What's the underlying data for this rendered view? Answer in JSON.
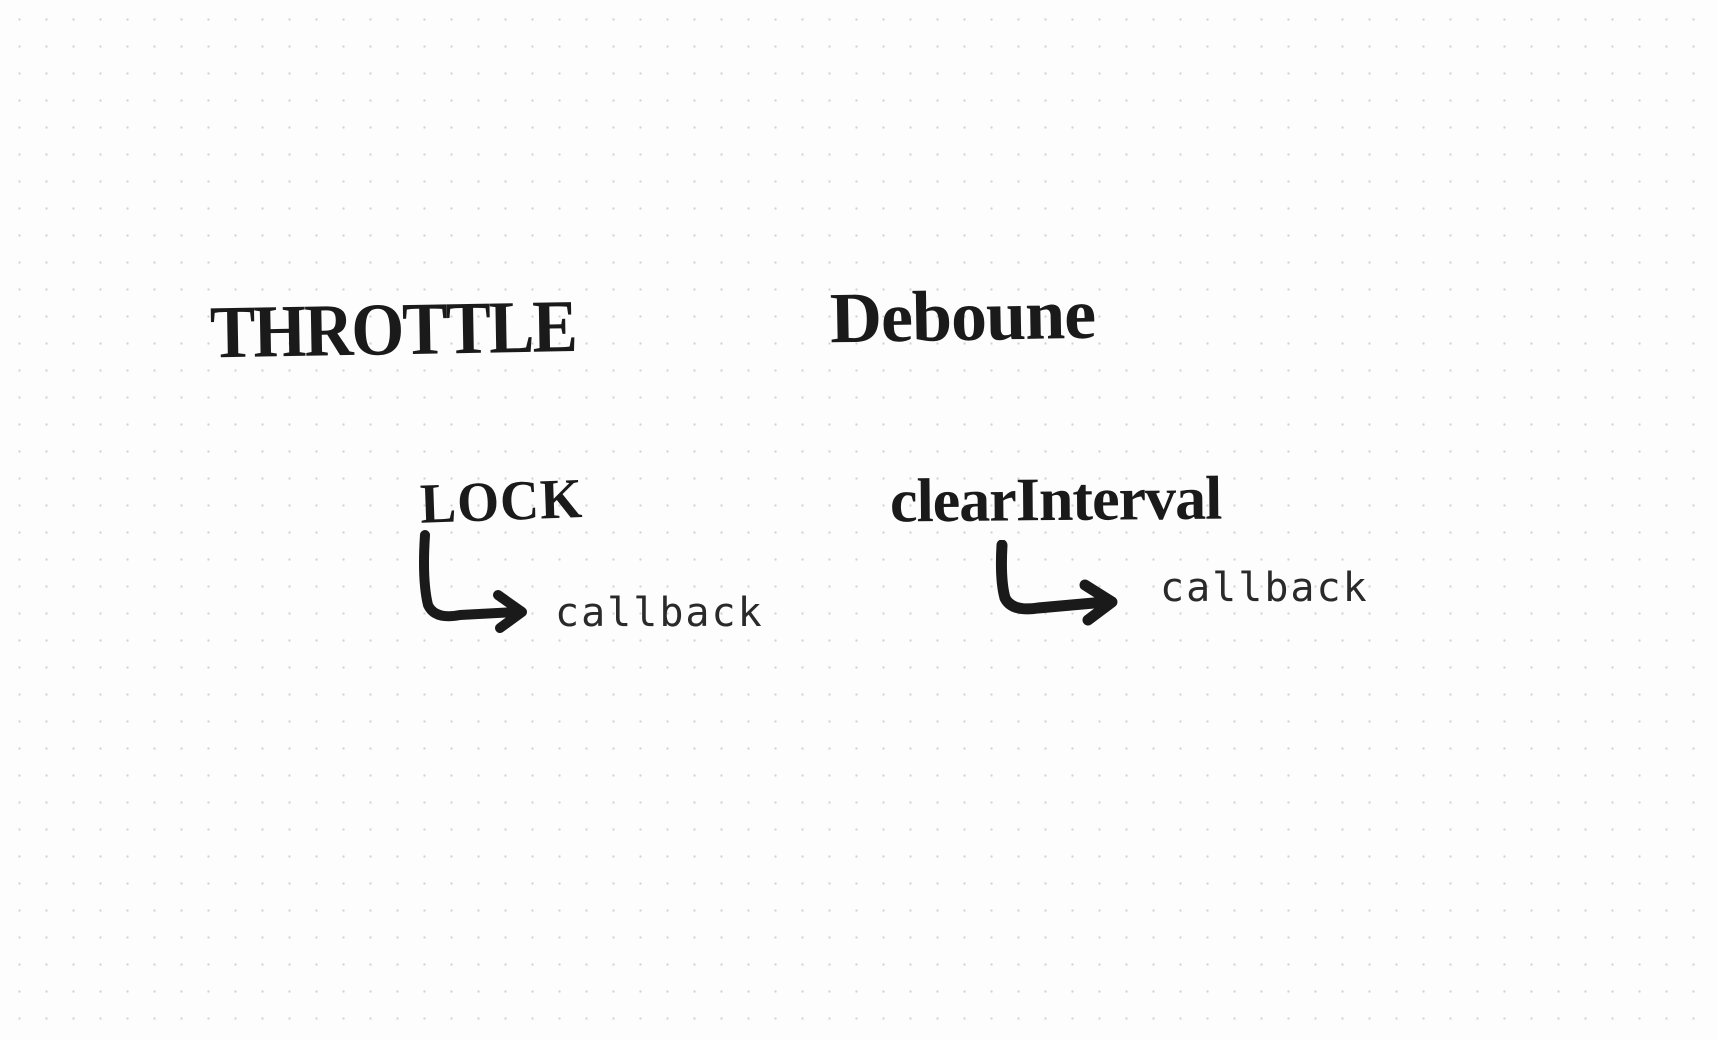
{
  "left": {
    "title": "THROTTLE",
    "concept": "LOCK",
    "result": "callback"
  },
  "right": {
    "title": "Deboune",
    "concept": "clearInterval",
    "result": "callback"
  }
}
